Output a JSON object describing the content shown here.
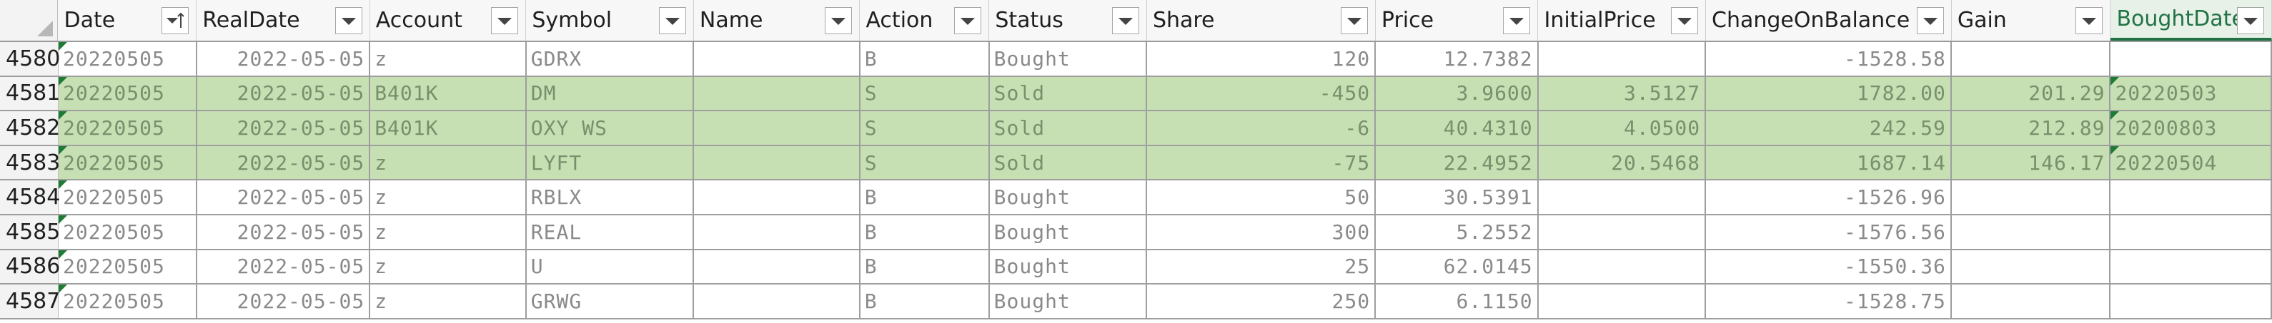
{
  "columns": [
    {
      "label": "Date",
      "sorted": true
    },
    {
      "label": "RealDate"
    },
    {
      "label": "Account"
    },
    {
      "label": "Symbol"
    },
    {
      "label": "Name"
    },
    {
      "label": "Action"
    },
    {
      "label": "Status"
    },
    {
      "label": "Share"
    },
    {
      "label": "Price"
    },
    {
      "label": "InitialPrice"
    },
    {
      "label": "ChangeOnBalance"
    },
    {
      "label": "Gain"
    },
    {
      "label": "BoughtDate"
    }
  ],
  "rows": [
    {
      "num": "4580",
      "highlight": false,
      "cells": [
        "20220505",
        "2022-05-05",
        "z",
        "GDRX",
        "",
        "B",
        "Bought",
        "120",
        "12.7382",
        "",
        "-1528.58",
        "",
        ""
      ]
    },
    {
      "num": "4581",
      "highlight": true,
      "cells": [
        "20220505",
        "2022-05-05",
        "B401K",
        "DM",
        "",
        "S",
        "Sold",
        "-450",
        "3.9600",
        "3.5127",
        "1782.00",
        "201.29",
        "20220503"
      ]
    },
    {
      "num": "4582",
      "highlight": true,
      "cells": [
        "20220505",
        "2022-05-05",
        "B401K",
        "OXY WS",
        "",
        "S",
        "Sold",
        "-6",
        "40.4310",
        "4.0500",
        "242.59",
        "212.89",
        "20200803"
      ]
    },
    {
      "num": "4583",
      "highlight": true,
      "cells": [
        "20220505",
        "2022-05-05",
        "z",
        "LYFT",
        "",
        "S",
        "Sold",
        "-75",
        "22.4952",
        "20.5468",
        "1687.14",
        "146.17",
        "20220504"
      ]
    },
    {
      "num": "4584",
      "highlight": false,
      "cells": [
        "20220505",
        "2022-05-05",
        "z",
        "RBLX",
        "",
        "B",
        "Bought",
        "50",
        "30.5391",
        "",
        "-1526.96",
        "",
        ""
      ]
    },
    {
      "num": "4585",
      "highlight": false,
      "cells": [
        "20220505",
        "2022-05-05",
        "z",
        "REAL",
        "",
        "B",
        "Bought",
        "300",
        "5.2552",
        "",
        "-1576.56",
        "",
        ""
      ]
    },
    {
      "num": "4586",
      "highlight": false,
      "cells": [
        "20220505",
        "2022-05-05",
        "z",
        "U",
        "",
        "B",
        "Bought",
        "25",
        "62.0145",
        "",
        "-1550.36",
        "",
        ""
      ]
    },
    {
      "num": "4587",
      "highlight": false,
      "cells": [
        "20220505",
        "2022-05-05",
        "z",
        "GRWG",
        "",
        "B",
        "Bought",
        "250",
        "6.1150",
        "",
        "-1528.75",
        "",
        ""
      ]
    }
  ],
  "selected_column": "BoughtDate",
  "colors": {
    "highlight": "#c6e0b4",
    "header": "#f3f3f3",
    "accent": "#217346",
    "marker": "#1e7b34"
  },
  "icons": {
    "filter": "dropdown-arrow-icon",
    "sort": "sort-ascending-icon"
  }
}
